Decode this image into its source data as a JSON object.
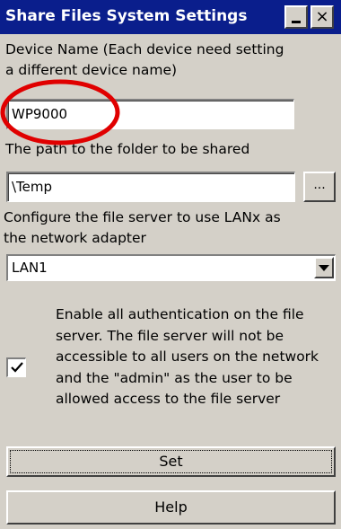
{
  "window": {
    "title": "Share Files System Settings",
    "minimize_label": "_",
    "close_label": "×"
  },
  "device_name": {
    "label_line1": "Device Name (Each device need setting",
    "label_line2": "a different device name)",
    "value": "WP9000"
  },
  "share_path": {
    "label": "The path to the folder to be shared",
    "value": "\\Temp",
    "browse_label": "..."
  },
  "adapter": {
    "label_line1": "Configure the file server to use LANx as",
    "label_line2": "the network adapter",
    "selected": "LAN1"
  },
  "auth": {
    "checked": true,
    "text": "Enable all authentication on the file server. The file server will not be accessible to all users on the network and the \"admin\" as the user to be allowed access to the file server"
  },
  "buttons": {
    "set_label": "Set",
    "help_label": "Help"
  },
  "colors": {
    "titlebar": "#0a1e8c",
    "window_bg": "#d4d0c8",
    "annotation": "#e00000"
  },
  "icons": {
    "minimize": "minimize-icon",
    "close": "close-icon",
    "dropdown": "chevron-down-icon",
    "check": "checkmark-icon",
    "highlight": "red-circle-annotation"
  }
}
